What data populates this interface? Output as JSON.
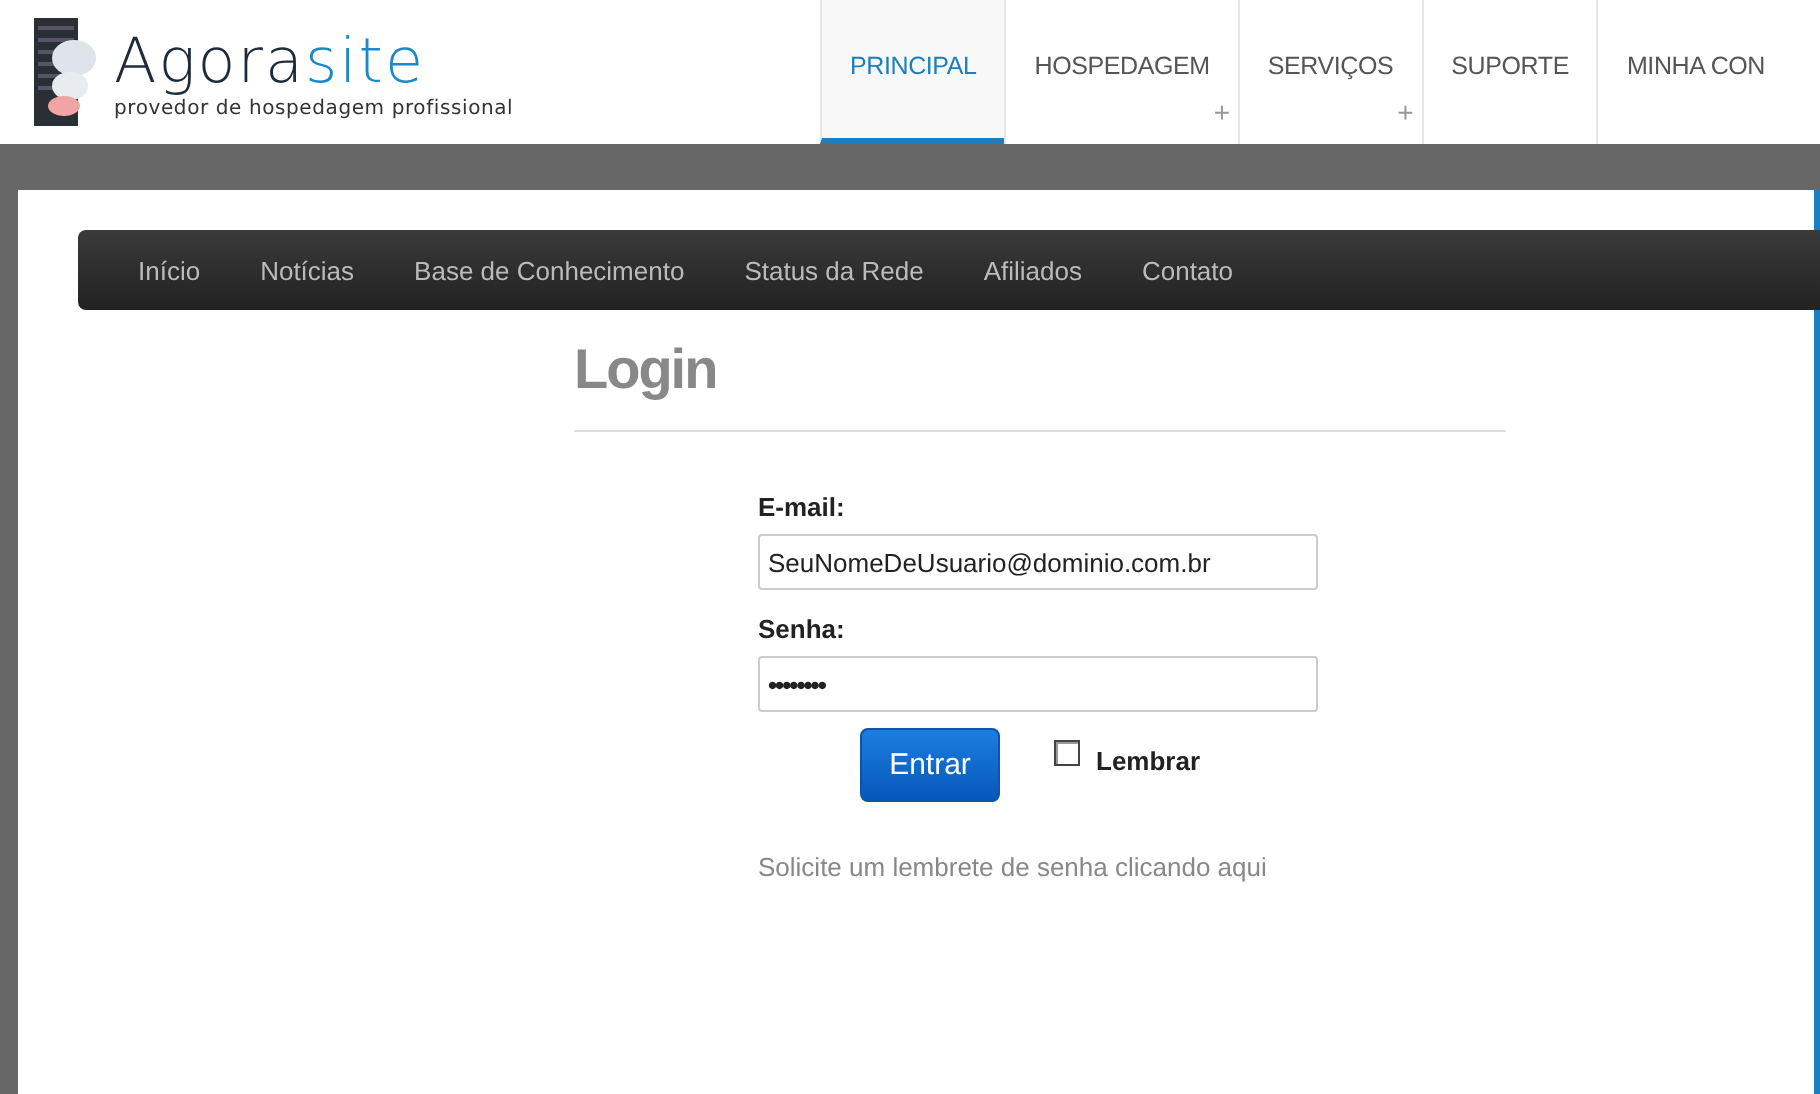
{
  "logo": {
    "name_main": "Agora",
    "name_accent": "site",
    "tagline": "provedor de hospedagem profissional"
  },
  "main_nav": [
    {
      "label": "PRINCIPAL",
      "selected": true,
      "expandable": false
    },
    {
      "label": "HOSPEDAGEM",
      "selected": false,
      "expandable": true
    },
    {
      "label": "SERVIÇOS",
      "selected": false,
      "expandable": true
    },
    {
      "label": "SUPORTE",
      "selected": false,
      "expandable": false
    },
    {
      "label": "MINHA CON",
      "selected": false,
      "expandable": false
    }
  ],
  "expand_mark": "+",
  "sub_nav": [
    "Início",
    "Notícias",
    "Base de Conhecimento",
    "Status da Rede",
    "Afiliados",
    "Contato"
  ],
  "login": {
    "title": "Login",
    "email_label": "E-mail:",
    "email_value": "SeuNomeDeUsuario@dominio.com.br",
    "password_label": "Senha:",
    "password_value": "••••••••",
    "submit": "Entrar",
    "remember": {
      "label": "Lembrar",
      "checked": false
    },
    "reminder_link": "Solicite um lembrete de senha clicando aqui"
  }
}
